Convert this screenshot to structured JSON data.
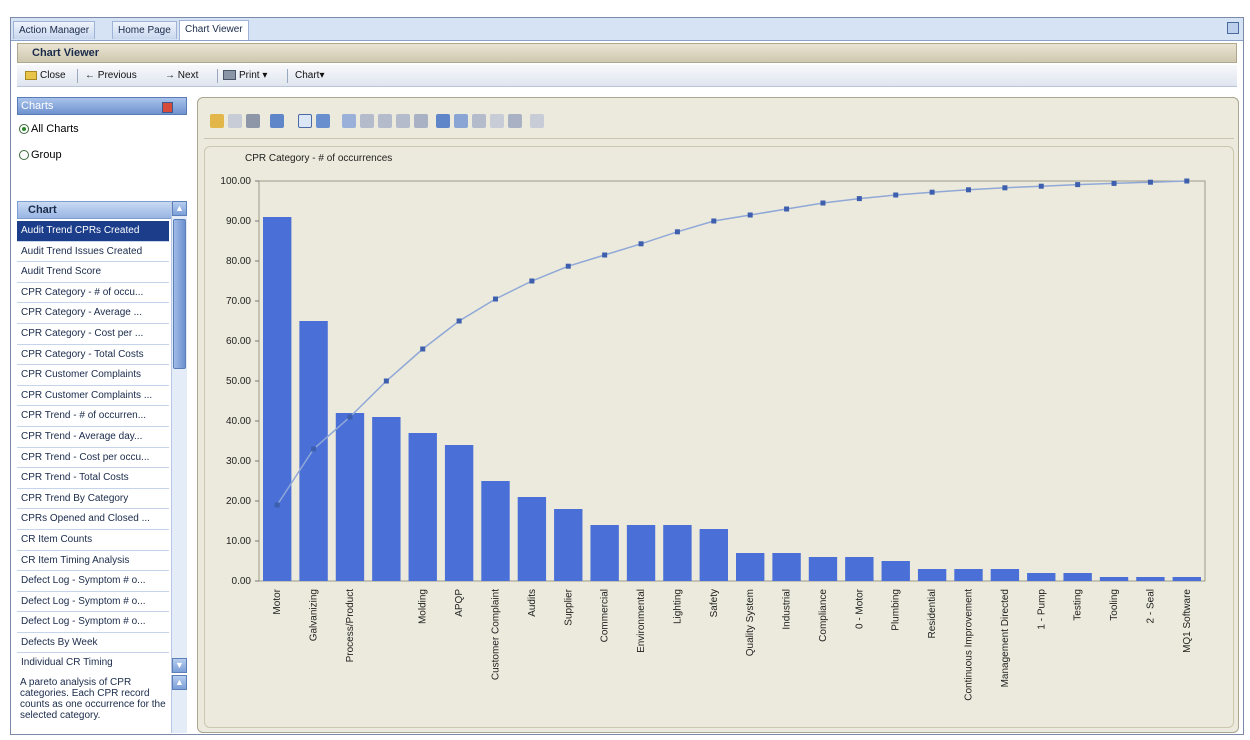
{
  "tabs": [
    {
      "label": "Action Manager"
    },
    {
      "label": "Home Page"
    },
    {
      "label": "Chart Viewer"
    }
  ],
  "window_title": "Chart Viewer",
  "toolbar": {
    "close": "Close",
    "previous": "Previous",
    "next": "Next",
    "print": "Print",
    "chart": "Chart"
  },
  "charts_panel": {
    "title": "Charts",
    "all_charts": "All Charts",
    "group": "Group"
  },
  "chart_list": {
    "title": "Chart",
    "items": [
      {
        "label": "Audit Trend CPRs Created"
      },
      {
        "label": "Audit Trend Issues Created"
      },
      {
        "label": "Audit Trend Score"
      },
      {
        "label": "CPR Category - # of occu..."
      },
      {
        "label": "CPR Category - Average ..."
      },
      {
        "label": "CPR Category - Cost per ..."
      },
      {
        "label": "CPR Category - Total Costs"
      },
      {
        "label": "CPR Customer Complaints"
      },
      {
        "label": "CPR Customer Complaints ..."
      },
      {
        "label": "CPR Trend - # of occurren..."
      },
      {
        "label": "CPR Trend - Average day..."
      },
      {
        "label": "CPR Trend - Cost per occu..."
      },
      {
        "label": "CPR Trend - Total Costs"
      },
      {
        "label": "CPR Trend By Category"
      },
      {
        "label": "CPRs Opened and Closed ..."
      },
      {
        "label": "CR Item Counts"
      },
      {
        "label": "CR Item Timing Analysis"
      },
      {
        "label": "Defect Log - Symptom # o..."
      },
      {
        "label": "Defect Log - Symptom # o..."
      },
      {
        "label": "Defect Log - Symptom # o..."
      },
      {
        "label": "Defects By Week"
      },
      {
        "label": "Individual CR Timing"
      }
    ],
    "selected_index": 0
  },
  "description": "A pareto analysis of CPR categories. Each CPR record counts as one occurrence for the selected category.",
  "chart_data": {
    "type": "bar",
    "title": "CPR Category - # of occurrences",
    "xlabel": "",
    "ylabel": "",
    "ylim": [
      0,
      100
    ],
    "yticks": [
      "100.00",
      "90.00",
      "80.00",
      "70.00",
      "60.00",
      "50.00",
      "40.00",
      "30.00",
      "20.00",
      "10.00",
      "0.00"
    ],
    "grid": false,
    "bar_color": "#4a6fd6",
    "line_color": "#8fa8d8",
    "categories": [
      "Motor",
      "Galvanizing",
      "Process/Product",
      "",
      "Molding",
      "APQP",
      "Customer Complaint",
      "Audits",
      "Supplier",
      "Commercial",
      "Environmental",
      "Lighting",
      "Safety",
      "Quality System",
      "Industrial",
      "Compliance",
      "0 - Motor",
      "Plumbing",
      "Residential",
      "Continuous Improvement",
      "Management Directed",
      "1 - Pump",
      "Testing",
      "Tooling",
      "2 - Seal",
      "MQ1 Software"
    ],
    "series": [
      {
        "type": "bar",
        "values": [
          91,
          65,
          42,
          41,
          37,
          34,
          25,
          21,
          18,
          14,
          14,
          14,
          13,
          7,
          7,
          6,
          6,
          5,
          3,
          3,
          3,
          2,
          2,
          1,
          1,
          1
        ]
      },
      {
        "type": "line",
        "values": [
          19,
          33,
          41,
          50,
          58,
          65,
          70.5,
          75,
          78.7,
          81.5,
          84.3,
          87.3,
          90,
          91.5,
          93,
          94.5,
          95.6,
          96.5,
          97.2,
          97.8,
          98.3,
          98.7,
          99.1,
          99.4,
          99.7,
          100
        ]
      }
    ]
  }
}
